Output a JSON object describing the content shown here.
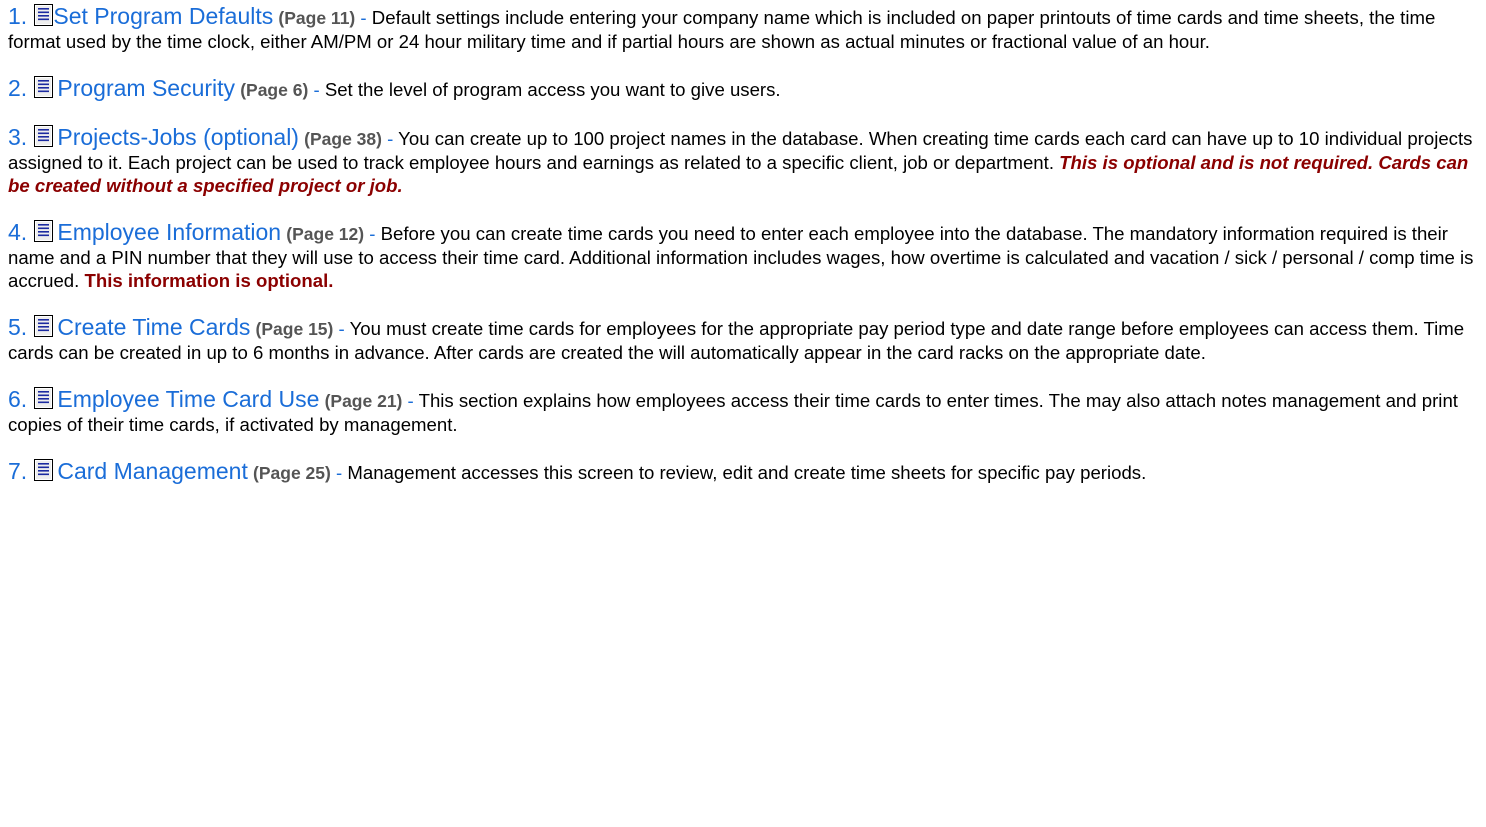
{
  "items": [
    {
      "number": "1.",
      "title": "Set Program Defaults",
      "page_ref": "(Page 11)",
      "dash": " - ",
      "text": "Default settings include entering your company name which is included on paper printouts of time cards and time sheets, the time format used by the time clock, either AM/PM or 24 hour military time and if partial hours are shown as actual minutes or fractional value of an hour.",
      "note": ""
    },
    {
      "number": "2.",
      "title": "Program Security",
      "page_ref": "(Page 6)",
      "dash": " - ",
      "text": "Set the level of program access you want to give users.",
      "note": ""
    },
    {
      "number": "3.",
      "title": "Projects-Jobs (optional)",
      "page_ref": "(Page 38)",
      "dash": " - ",
      "text": "You can create up to 100 project names in the database. When creating time cards each card can have up to 10 individual projects assigned to it. Each project can be used to track employee hours and earnings as related to a specific client, job or department. ",
      "note": "This is optional and is not required. Cards can be created without a specified project or job."
    },
    {
      "number": "4.",
      "title": "Employee Information",
      "page_ref": "(Page 12)",
      "dash": " - ",
      "text": "Before you can create time cards you need to enter each employee into the database. The mandatory information required is their name and a PIN number that they will use to access their time card. Additional information includes wages, how overtime is calculated and vacation / sick / personal / comp time is accrued. ",
      "note": "This information is optional."
    },
    {
      "number": "5.",
      "title": "Create Time Cards",
      "page_ref": "(Page 15)",
      "dash": " - ",
      "text": "You must create time cards for employees for the appropriate pay period type and date range before employees can access them. Time cards can be created in up to 6 months in advance. After cards are created the will automatically appear in the card racks on the appropriate date.",
      "note": ""
    },
    {
      "number": "6.",
      "title": "Employee Time Card Use",
      "page_ref": "(Page 21)",
      "dash": " - ",
      "text": "This section explains how employees access their time cards to enter times. The may also attach notes management and print copies of their time cards, if activated by management.",
      "note": ""
    },
    {
      "number": "7.",
      "title": "Card Management",
      "page_ref": "(Page 25)",
      "dash": " - ",
      "text": "Management accesses this screen to review, edit and create time sheets for specific pay periods.",
      "note": ""
    }
  ],
  "icon": "document-icon",
  "colors": {
    "link": "#1a6dd8",
    "page_ref": "#555555",
    "note": "#8b0000",
    "text": "#000000"
  }
}
